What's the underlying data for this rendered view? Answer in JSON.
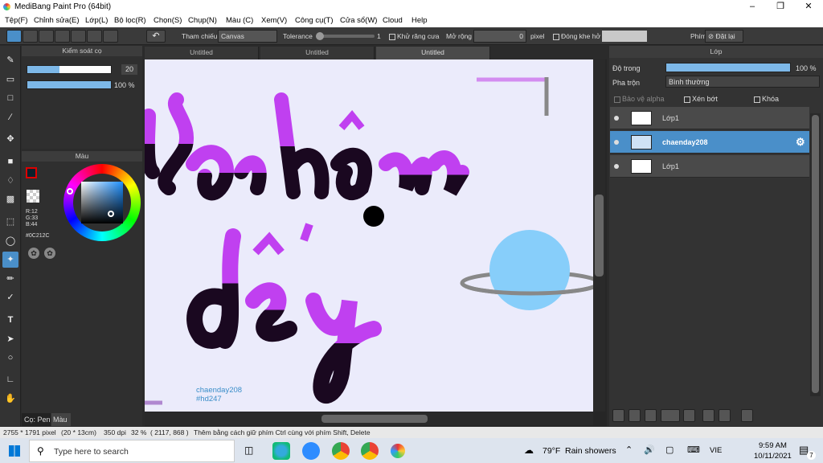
{
  "window": {
    "title": "MediBang Paint Pro (64bit)"
  },
  "menu": [
    "Tệp(F)",
    "Chỉnh sửa(E)",
    "Lớp(L)",
    "Bộ lọc(R)",
    "Chọn(S)",
    "Chụp(N)",
    "Màu (C)",
    "Xem(V)",
    "Công cụ(T)",
    "Cửa sổ(W)",
    "Cloud",
    "Help"
  ],
  "toolbar": {
    "reference_label": "Tham chiếu",
    "reference_value": "Canvas",
    "tolerance_label": "Tolerance",
    "tolerance_value": "1",
    "antialias_label": "Khử răng cưa",
    "expand_label": "Mở rộng",
    "expand_value": "0",
    "expand_unit": "pixel",
    "close_gap_label": "Đóng khe hở",
    "keys_label": "Phím",
    "reset_label": "Đặt lại"
  },
  "brush_panel": {
    "title": "Kiểm soát cọ",
    "size_value": "20",
    "size_fill": 0.38,
    "opacity_value": "100 %",
    "opacity_fill": 1.0
  },
  "color_panel": {
    "title": "Màu",
    "r": "R:12",
    "g": "G:33",
    "b": "B:44",
    "hex": "#0C212C"
  },
  "bottom_tabs": {
    "brush": "Cọ: Pen",
    "color": "Màu"
  },
  "doc_tabs": [
    "Untitled",
    "Untitled",
    "Untitled"
  ],
  "canvas_text": {
    "line1": "chaenday208",
    "line2": "#hd247"
  },
  "layers_panel": {
    "title": "Lớp",
    "opacity_label": "Độ trong",
    "opacity_value": "100 %",
    "opacity_fill": 1.0,
    "blend_label": "Pha trộn",
    "blend_value": "Bình thường",
    "protect_alpha": "Bảo vệ alpha",
    "clipping": "Xén bớt",
    "lock": "Khóa",
    "layers": [
      {
        "name": "Lớp1",
        "selected": false
      },
      {
        "name": "chaenday208",
        "selected": true
      },
      {
        "name": "Lớp1",
        "selected": false
      }
    ]
  },
  "status": {
    "size": "2755 * 1791 pixel",
    "cm": "(20 * 13cm)",
    "dpi": "350 dpi",
    "zoom": "32 %",
    "coords": "( 2117, 868 )",
    "hint": "Thêm bằng cách giữ phím Ctrl cùng với phím Shift, Delete"
  },
  "taskbar": {
    "search_placeholder": "Type here to search",
    "weather_temp": "79°F",
    "weather_desc": "Rain showers",
    "lang": "VIE",
    "time": "9:59 AM",
    "date": "10/11/2021",
    "notif_count": "7"
  },
  "colors": {
    "accent": "#4a8fc9",
    "purple": "#c040f0",
    "dark": "#1a0820",
    "planet": "#87cefa"
  }
}
